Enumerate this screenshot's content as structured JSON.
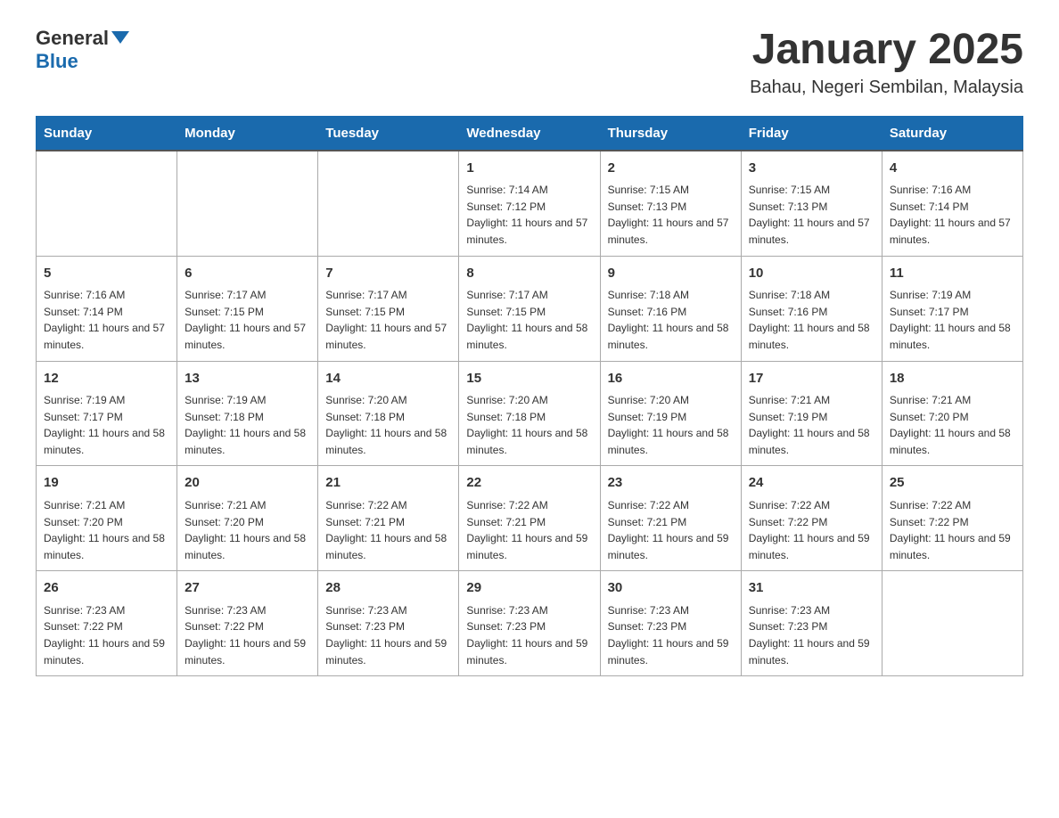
{
  "header": {
    "logo_text_main": "General",
    "logo_text_blue": "Blue",
    "calendar_title": "January 2025",
    "calendar_subtitle": "Bahau, Negeri Sembilan, Malaysia"
  },
  "columns": [
    "Sunday",
    "Monday",
    "Tuesday",
    "Wednesday",
    "Thursday",
    "Friday",
    "Saturday"
  ],
  "weeks": [
    [
      {
        "day": "",
        "info": ""
      },
      {
        "day": "",
        "info": ""
      },
      {
        "day": "",
        "info": ""
      },
      {
        "day": "1",
        "info": "Sunrise: 7:14 AM\nSunset: 7:12 PM\nDaylight: 11 hours and 57 minutes."
      },
      {
        "day": "2",
        "info": "Sunrise: 7:15 AM\nSunset: 7:13 PM\nDaylight: 11 hours and 57 minutes."
      },
      {
        "day": "3",
        "info": "Sunrise: 7:15 AM\nSunset: 7:13 PM\nDaylight: 11 hours and 57 minutes."
      },
      {
        "day": "4",
        "info": "Sunrise: 7:16 AM\nSunset: 7:14 PM\nDaylight: 11 hours and 57 minutes."
      }
    ],
    [
      {
        "day": "5",
        "info": "Sunrise: 7:16 AM\nSunset: 7:14 PM\nDaylight: 11 hours and 57 minutes."
      },
      {
        "day": "6",
        "info": "Sunrise: 7:17 AM\nSunset: 7:15 PM\nDaylight: 11 hours and 57 minutes."
      },
      {
        "day": "7",
        "info": "Sunrise: 7:17 AM\nSunset: 7:15 PM\nDaylight: 11 hours and 57 minutes."
      },
      {
        "day": "8",
        "info": "Sunrise: 7:17 AM\nSunset: 7:15 PM\nDaylight: 11 hours and 58 minutes."
      },
      {
        "day": "9",
        "info": "Sunrise: 7:18 AM\nSunset: 7:16 PM\nDaylight: 11 hours and 58 minutes."
      },
      {
        "day": "10",
        "info": "Sunrise: 7:18 AM\nSunset: 7:16 PM\nDaylight: 11 hours and 58 minutes."
      },
      {
        "day": "11",
        "info": "Sunrise: 7:19 AM\nSunset: 7:17 PM\nDaylight: 11 hours and 58 minutes."
      }
    ],
    [
      {
        "day": "12",
        "info": "Sunrise: 7:19 AM\nSunset: 7:17 PM\nDaylight: 11 hours and 58 minutes."
      },
      {
        "day": "13",
        "info": "Sunrise: 7:19 AM\nSunset: 7:18 PM\nDaylight: 11 hours and 58 minutes."
      },
      {
        "day": "14",
        "info": "Sunrise: 7:20 AM\nSunset: 7:18 PM\nDaylight: 11 hours and 58 minutes."
      },
      {
        "day": "15",
        "info": "Sunrise: 7:20 AM\nSunset: 7:18 PM\nDaylight: 11 hours and 58 minutes."
      },
      {
        "day": "16",
        "info": "Sunrise: 7:20 AM\nSunset: 7:19 PM\nDaylight: 11 hours and 58 minutes."
      },
      {
        "day": "17",
        "info": "Sunrise: 7:21 AM\nSunset: 7:19 PM\nDaylight: 11 hours and 58 minutes."
      },
      {
        "day": "18",
        "info": "Sunrise: 7:21 AM\nSunset: 7:20 PM\nDaylight: 11 hours and 58 minutes."
      }
    ],
    [
      {
        "day": "19",
        "info": "Sunrise: 7:21 AM\nSunset: 7:20 PM\nDaylight: 11 hours and 58 minutes."
      },
      {
        "day": "20",
        "info": "Sunrise: 7:21 AM\nSunset: 7:20 PM\nDaylight: 11 hours and 58 minutes."
      },
      {
        "day": "21",
        "info": "Sunrise: 7:22 AM\nSunset: 7:21 PM\nDaylight: 11 hours and 58 minutes."
      },
      {
        "day": "22",
        "info": "Sunrise: 7:22 AM\nSunset: 7:21 PM\nDaylight: 11 hours and 59 minutes."
      },
      {
        "day": "23",
        "info": "Sunrise: 7:22 AM\nSunset: 7:21 PM\nDaylight: 11 hours and 59 minutes."
      },
      {
        "day": "24",
        "info": "Sunrise: 7:22 AM\nSunset: 7:22 PM\nDaylight: 11 hours and 59 minutes."
      },
      {
        "day": "25",
        "info": "Sunrise: 7:22 AM\nSunset: 7:22 PM\nDaylight: 11 hours and 59 minutes."
      }
    ],
    [
      {
        "day": "26",
        "info": "Sunrise: 7:23 AM\nSunset: 7:22 PM\nDaylight: 11 hours and 59 minutes."
      },
      {
        "day": "27",
        "info": "Sunrise: 7:23 AM\nSunset: 7:22 PM\nDaylight: 11 hours and 59 minutes."
      },
      {
        "day": "28",
        "info": "Sunrise: 7:23 AM\nSunset: 7:23 PM\nDaylight: 11 hours and 59 minutes."
      },
      {
        "day": "29",
        "info": "Sunrise: 7:23 AM\nSunset: 7:23 PM\nDaylight: 11 hours and 59 minutes."
      },
      {
        "day": "30",
        "info": "Sunrise: 7:23 AM\nSunset: 7:23 PM\nDaylight: 11 hours and 59 minutes."
      },
      {
        "day": "31",
        "info": "Sunrise: 7:23 AM\nSunset: 7:23 PM\nDaylight: 11 hours and 59 minutes."
      },
      {
        "day": "",
        "info": ""
      }
    ]
  ]
}
